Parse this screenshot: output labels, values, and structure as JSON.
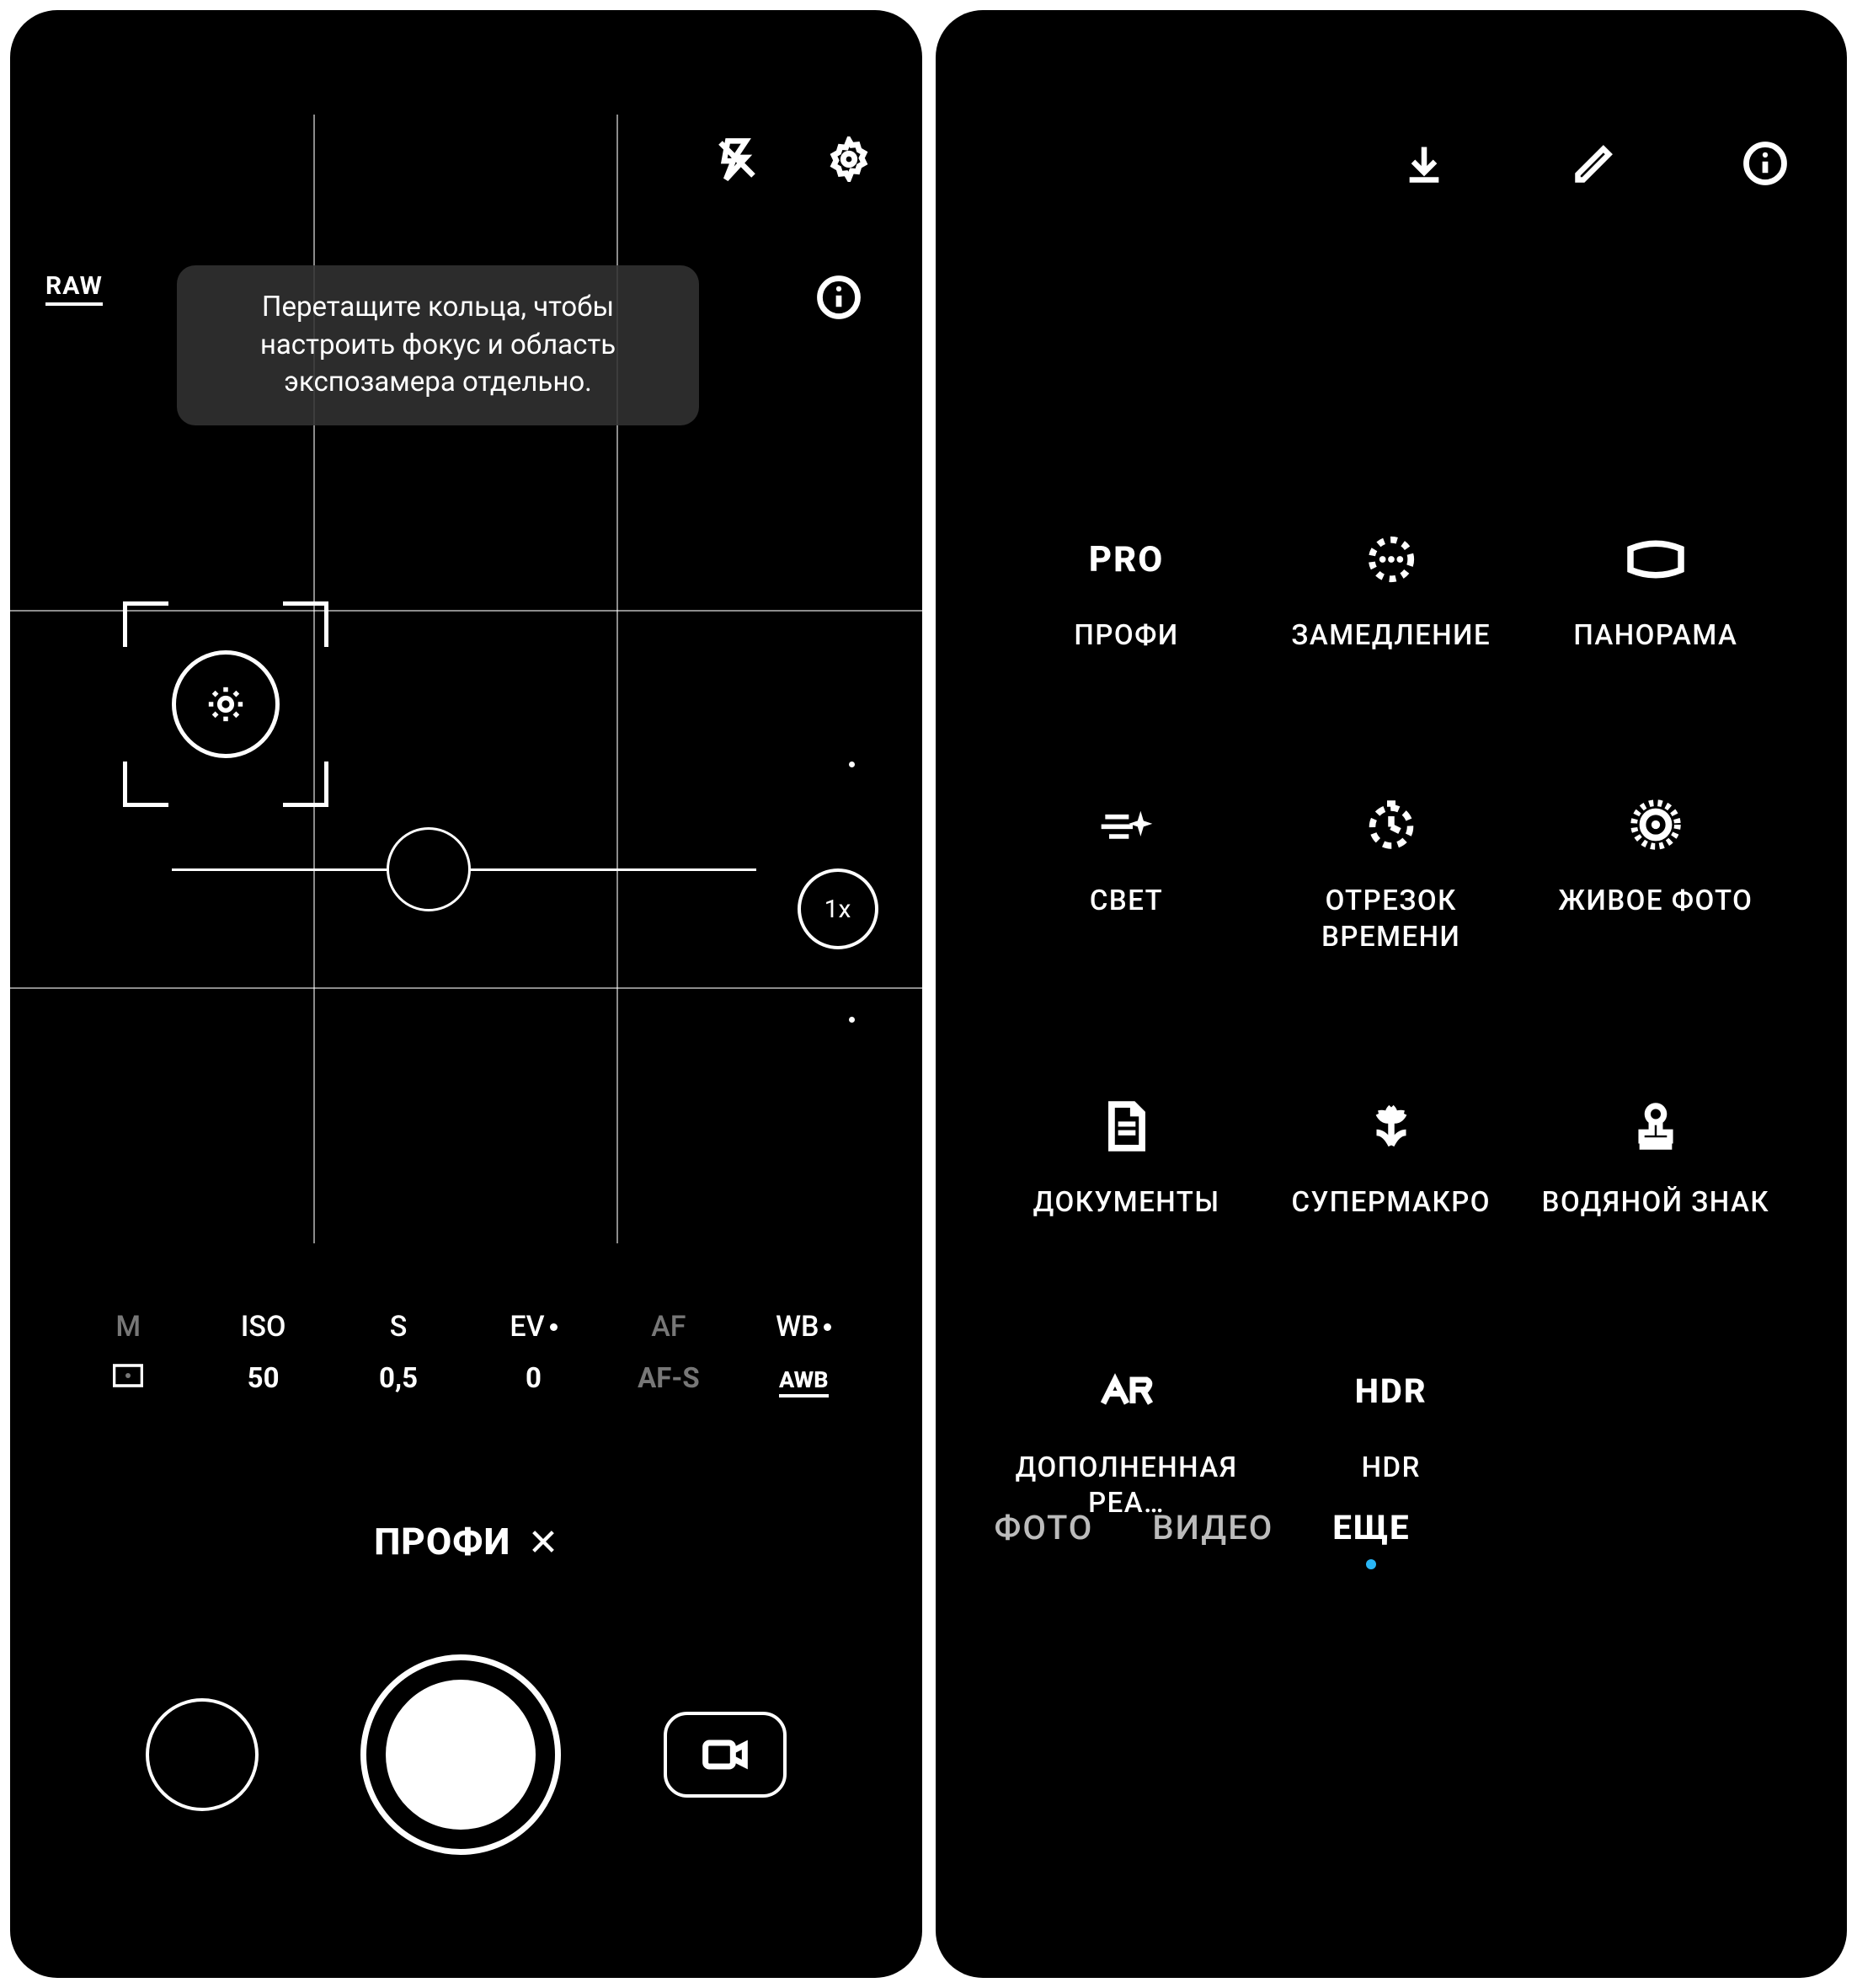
{
  "left": {
    "raw": "RAW",
    "tooltip": "Перетащите кольца, чтобы настроить фокус и область экспозамера отдельно.",
    "zoom": "1x",
    "pro_params": {
      "m": {
        "top": "M",
        "bot_icon": "metering"
      },
      "iso": {
        "top": "ISO",
        "bot": "50"
      },
      "s": {
        "top": "S",
        "bot": "0,5"
      },
      "ev": {
        "top": "EV",
        "bot": "0"
      },
      "af": {
        "top": "AF",
        "bot": "AF-S"
      },
      "wb": {
        "top": "WB",
        "bot": "AWB"
      }
    },
    "mode_label": "ПРОФИ"
  },
  "right": {
    "tiles": {
      "pro": {
        "label": "ПРОФИ"
      },
      "slowmo": {
        "label": "ЗАМЕДЛЕНИЕ"
      },
      "panorama": {
        "label": "ПАНОРАМА"
      },
      "light": {
        "label": "СВЕТ"
      },
      "timelapse": {
        "label": "ОТРЕЗОК ВРЕМЕНИ"
      },
      "livephoto": {
        "label": "ЖИВОЕ ФОТО"
      },
      "documents": {
        "label": "ДОКУМЕНТЫ"
      },
      "supermacro": {
        "label": "СУПЕРМАКРО"
      },
      "watermark": {
        "label": "ВОДЯНОЙ ЗНАК"
      },
      "ar": {
        "label": "ДОПОЛНЕННАЯ РЕА…"
      },
      "hdr": {
        "label": "HDR"
      }
    },
    "tile_pro_text": "PRO",
    "tile_hdr_text": "HDR",
    "tabs": {
      "photo": "ФОТО",
      "video": "ВИДЕО",
      "more": "ЕЩЕ"
    }
  }
}
